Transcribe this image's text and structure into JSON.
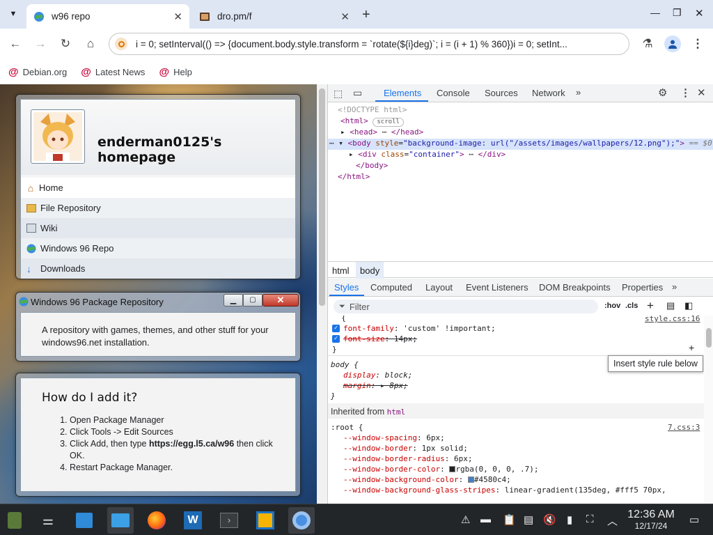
{
  "tabs": [
    {
      "title": "w96 repo",
      "active": true
    },
    {
      "title": "dro.pm/f",
      "active": false
    }
  ],
  "address": {
    "url": "i = 0; setInterval(() => {document.body.style.transform = `rotate(${i}deg)`; i = (i + 1) % 360})i = 0; setInt..."
  },
  "bookmarks": [
    {
      "label": "Debian.org"
    },
    {
      "label": "Latest News"
    },
    {
      "label": "Help"
    }
  ],
  "site": {
    "heading": "enderman0125's homepage",
    "nav": [
      {
        "label": "Home",
        "icon": "home-icon"
      },
      {
        "label": "File Repository",
        "icon": "folder-icon"
      },
      {
        "label": "Wiki",
        "icon": "book-icon"
      },
      {
        "label": "Windows 96 Repo",
        "icon": "globe-icon"
      },
      {
        "label": "Downloads",
        "icon": "download-icon"
      }
    ],
    "window_title": "Windows 96 Package Repository",
    "description": "A repository with games, themes, and other stuff for your windows96.net installation.",
    "howto_title": "How do I add it?",
    "steps": [
      {
        "text": "Open Package Manager"
      },
      {
        "text": "Click Tools -> Edit Sources"
      },
      {
        "pre": "Click Add, then type ",
        "bold": "https://egg.l5.ca/w96",
        "post": " then click OK."
      },
      {
        "text": "Restart Package Manager."
      }
    ]
  },
  "devtools": {
    "tabs": [
      "Elements",
      "Console",
      "Sources",
      "Network"
    ],
    "doctype": "<!DOCTYPE html>",
    "scroll_badge": "scroll",
    "body_style": "background-image: url(\"/assets/images/wallpapers/12.png\");",
    "container_class": "container",
    "eq": "== $0",
    "breadcrumbs": [
      "html",
      "body"
    ],
    "style_tabs": [
      "Styles",
      "Computed",
      "Layout",
      "Event Listeners",
      "DOM Breakpoints",
      "Properties"
    ],
    "filter_placeholder": "Filter",
    "hov": ":hov",
    "cls": ".cls",
    "rule1": {
      "source": "style.css:16",
      "props": [
        {
          "name": "font-family",
          "value": "'custom' !important;"
        },
        {
          "name": "font-size",
          "value": "14px;"
        }
      ]
    },
    "tooltip": "Insert style rule below",
    "rule2": {
      "selector": "body {",
      "props": [
        {
          "name": "display",
          "value": "block;"
        },
        {
          "name": "margin",
          "value": "8px;"
        }
      ]
    },
    "inherited_label": "Inherited from",
    "inherited_tag": "html",
    "root_rule": {
      "selector": ":root {",
      "source": "7.css:3",
      "props": [
        {
          "name": "--window-spacing",
          "value": "6px;"
        },
        {
          "name": "--window-border",
          "value": "1px solid;"
        },
        {
          "name": "--window-border-radius",
          "value": "6px;"
        },
        {
          "name": "--window-border-color",
          "value": "rgba(0, 0, 0, .7);"
        },
        {
          "name": "--window-background-color",
          "value": "#4580c4;"
        },
        {
          "name": "--window-background-glass-stripes",
          "value": "linear-gradient(135deg, #fff5 70px,"
        }
      ]
    }
  },
  "clock": {
    "time": "12:36 AM",
    "date": "12/17/24"
  },
  "colors": {
    "accent": "#1a73e8",
    "devtools_active": "#1a73e8",
    "win96_blue": "#4580c4"
  }
}
